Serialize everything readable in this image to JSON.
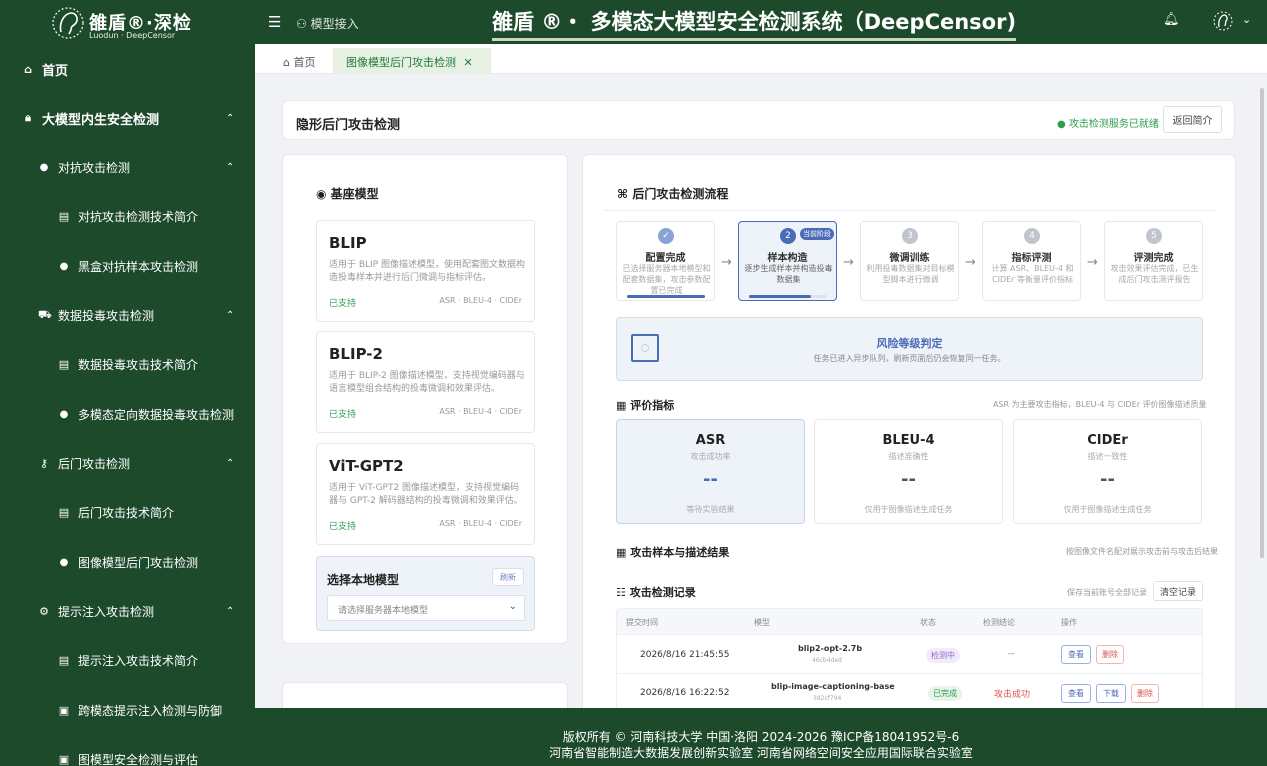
{
  "header": {
    "logo_title": "雒盾®·深检",
    "logo_subtitle": "Luodun · DeepCensor",
    "nav_label": "模型接入",
    "system_title": "雒盾 ®・ 多模态大模型安全检测系统（DeepCensor)",
    "icons": [
      "menu-icon",
      "bell-icon",
      "avatar-icon",
      "chevron-down-icon"
    ]
  },
  "sidebar": {
    "items": [
      {
        "label": "首页",
        "icon": "home-icon",
        "level": 0
      },
      {
        "label": "大模型内生安全检测",
        "icon": "lock-icon",
        "level": 0,
        "expanded": true
      },
      {
        "label": "对抗攻击检测",
        "icon": "alert-icon",
        "level": 1,
        "expanded": true
      },
      {
        "label": "对抗攻击检测技术简介",
        "icon": "document-icon",
        "level": 2
      },
      {
        "label": "黑盒对抗样本攻击检测",
        "icon": "alert-icon",
        "level": 2
      },
      {
        "label": "数据投毒攻击检测",
        "icon": "cart-icon",
        "level": 1,
        "expanded": true
      },
      {
        "label": "数据投毒攻击技术简介",
        "icon": "document-icon",
        "level": 2
      },
      {
        "label": "多模态定向数据投毒攻击检测",
        "icon": "alert-icon",
        "level": 2
      },
      {
        "label": "后门攻击检测",
        "icon": "key-icon",
        "level": 1,
        "expanded": true
      },
      {
        "label": "后门攻击技术简介",
        "icon": "document-icon",
        "level": 2
      },
      {
        "label": "图像模型后门攻击检测",
        "icon": "alert-icon",
        "level": 2
      },
      {
        "label": "提示注入攻击检测",
        "icon": "robot-icon",
        "level": 1,
        "expanded": true
      },
      {
        "label": "提示注入攻击技术简介",
        "icon": "document-icon",
        "level": 2
      },
      {
        "label": "跨模态提示注入检测与防御",
        "icon": "save-icon",
        "level": 2
      },
      {
        "label": "图模型安全检测与评估",
        "icon": "save-icon",
        "level": 2
      }
    ]
  },
  "tabs": {
    "home": "首页",
    "active": "图像模型后门攻击检测"
  },
  "page_header": {
    "title": "隐形后门攻击检测",
    "status": "攻击检测服务已就绪",
    "status_color": "#2e9e4b",
    "back_button": "返回简介"
  },
  "base_models": {
    "title": "基座模型",
    "cards": [
      {
        "name": "BLIP",
        "desc": "适用于 BLIP 图像描述模型，使用配套图文数据构造投毒样本并进行后门微调与指标评估。",
        "status": "已支持",
        "metrics": "ASR · BLEU-4 · CIDEr"
      },
      {
        "name": "BLIP-2",
        "desc": "适用于 BLIP-2 图像描述模型，支持视觉编码器与语言模型组合结构的投毒微调和效果评估。",
        "status": "已支持",
        "metrics": "ASR · BLEU-4 · CIDEr"
      },
      {
        "name": "ViT-GPT2",
        "desc": "适用于 ViT-GPT2 图像描述模型，支持视觉编码器与 GPT-2 解码器结构的投毒微调和效果评估。",
        "status": "已支持",
        "metrics": "ASR · BLEU-4 · CIDEr"
      }
    ],
    "local_model_title": "选择本地模型",
    "refresh_button": "刷新",
    "select_placeholder": "请选择服务器本地模型"
  },
  "flow": {
    "title": "后门攻击检测流程",
    "current_badge": "当前阶段",
    "steps": [
      {
        "num": "✓",
        "title": "配置完成",
        "desc": "已选择服务器本地模型和配套数据集，攻击参数配置已完成",
        "state": "done",
        "progress": 1.0
      },
      {
        "num": "2",
        "title": "样本构造",
        "desc": "逐步生成样本并构造投毒数据集",
        "state": "active",
        "progress": 0.8
      },
      {
        "num": "3",
        "title": "微调训练",
        "desc": "利用投毒数据集对目标模型脚本进行微调",
        "state": "pending"
      },
      {
        "num": "4",
        "title": "指标评测",
        "desc": "计算 ASR、BLEU-4 和 CIDEr 等衡量评价指标",
        "state": "pending"
      },
      {
        "num": "5",
        "title": "评测完成",
        "desc": "攻击效果评估完成，已生成后门攻击测评报告",
        "state": "pending"
      }
    ],
    "risk_title": "风险等级判定",
    "risk_desc": "任务已进入异步队列，刷新页面后仍会恢复同一任务。"
  },
  "metrics": {
    "title": "评价指标",
    "note": "ASR 为主要攻击指标，BLEU-4 与 CIDEr 评价图像描述质量",
    "items": [
      {
        "name": "ASR",
        "sub": "攻击成功率",
        "value": "--",
        "foot": "等待实验结果"
      },
      {
        "name": "BLEU-4",
        "sub": "描述准确性",
        "value": "--",
        "foot": "仅用于图像描述生成任务"
      },
      {
        "name": "CIDEr",
        "sub": "描述一致性",
        "value": "--",
        "foot": "仅用于图像描述生成任务"
      }
    ]
  },
  "samples": {
    "title": "攻击样本与描述结果",
    "note": "按图像文件名配对展示攻击前与攻击后结果"
  },
  "records": {
    "title": "攻击检测记录",
    "note": "保存当前账号全部记录",
    "clear_button": "清空记录",
    "columns": [
      "提交时间",
      "模型",
      "状态",
      "检测结论",
      "操作"
    ],
    "rows": [
      {
        "time": "2026/8/16 21:45:55",
        "model": "blip2-opt-2.7b",
        "model_id": "46cb4ded",
        "status": "检测中",
        "conclusion": "--",
        "actions": [
          "查看",
          "删除"
        ]
      },
      {
        "time": "2026/8/16 16:22:52",
        "model": "blip-image-captioning-base",
        "model_id": "382cf794",
        "status": "已完成",
        "conclusion": "攻击成功",
        "actions": [
          "查看",
          "下载",
          "删除"
        ]
      }
    ]
  },
  "footer": {
    "line1": "版权所有 © 河南科技大学  中国·洛阳  2024-2026     豫ICP备18041952号-6",
    "line2": "河南省智能制造大数据发展创新实验室  河南省网络空间安全应用国际联合实验室"
  }
}
